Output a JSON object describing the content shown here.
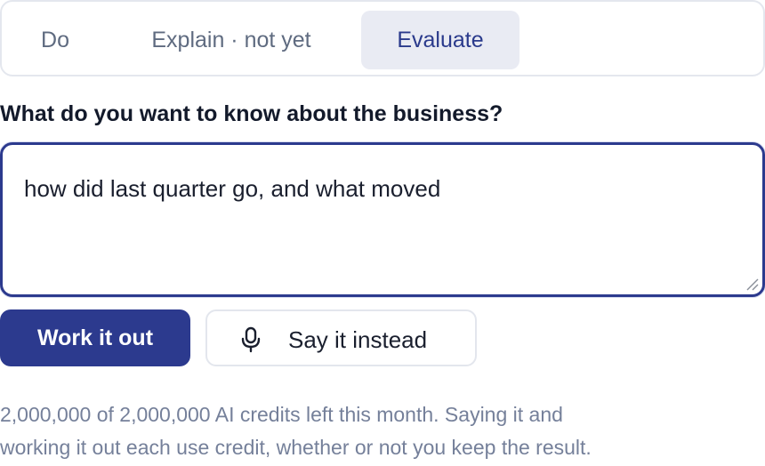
{
  "tabs": [
    {
      "label": "Do"
    },
    {
      "label": "Explain · not yet"
    },
    {
      "label": "Evaluate",
      "selected": true
    }
  ],
  "question": {
    "label": "What do you want to know about the business?",
    "value": "how did last quarter go, and what moved"
  },
  "actions": {
    "primary_label": "Work it out",
    "secondary_label": "Say it instead",
    "secondary_icon": "microphone-icon"
  },
  "credits": {
    "line1": "2,000,000 of 2,000,000 AI credits left this month. Saying it and",
    "line2": "working it out each use credit, whether or not you keep the result."
  },
  "colors": {
    "accent": "#2c3a8e",
    "selected_tab_bg": "#e9ebf3",
    "muted_text": "#75809a"
  }
}
